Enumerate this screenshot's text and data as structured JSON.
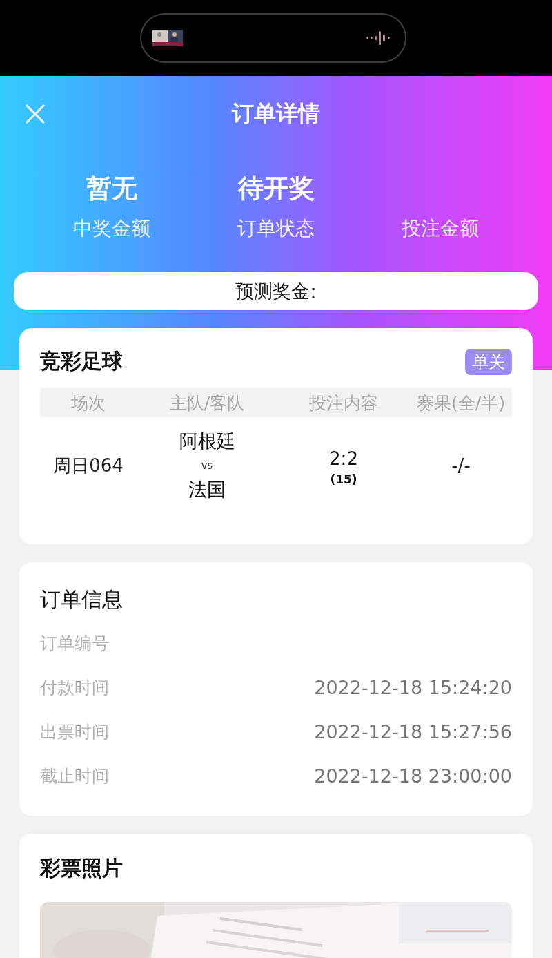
{
  "header": {
    "title": "订单详情",
    "stats": [
      {
        "value": "暂无",
        "label": "中奖金额"
      },
      {
        "value": "待开奖",
        "label": "订单状态"
      },
      {
        "label": "投注金额"
      }
    ],
    "prediction": {
      "label": "预测奖金:"
    }
  },
  "match_card": {
    "title": "竞彩足球",
    "badge": "单关",
    "columns": [
      "场次",
      "主队/客队",
      "投注内容",
      "赛果(全/半)"
    ],
    "rows": [
      {
        "session": "周日064",
        "home": "阿根廷",
        "vs": "vs",
        "away": "法国",
        "pick": "2:2",
        "odds": "(15)",
        "result": "-/-"
      }
    ]
  },
  "order_info": {
    "title": "订单信息",
    "rows": [
      {
        "label": "订单编号"
      },
      {
        "label": "付款时间",
        "value": "2022-12-18 15:24:20"
      },
      {
        "label": "出票时间",
        "value": "2022-12-18 15:27:56"
      },
      {
        "label": "截止时间",
        "value": "2022-12-18 23:00:00"
      }
    ]
  },
  "photo_card": {
    "title": "彩票照片"
  }
}
